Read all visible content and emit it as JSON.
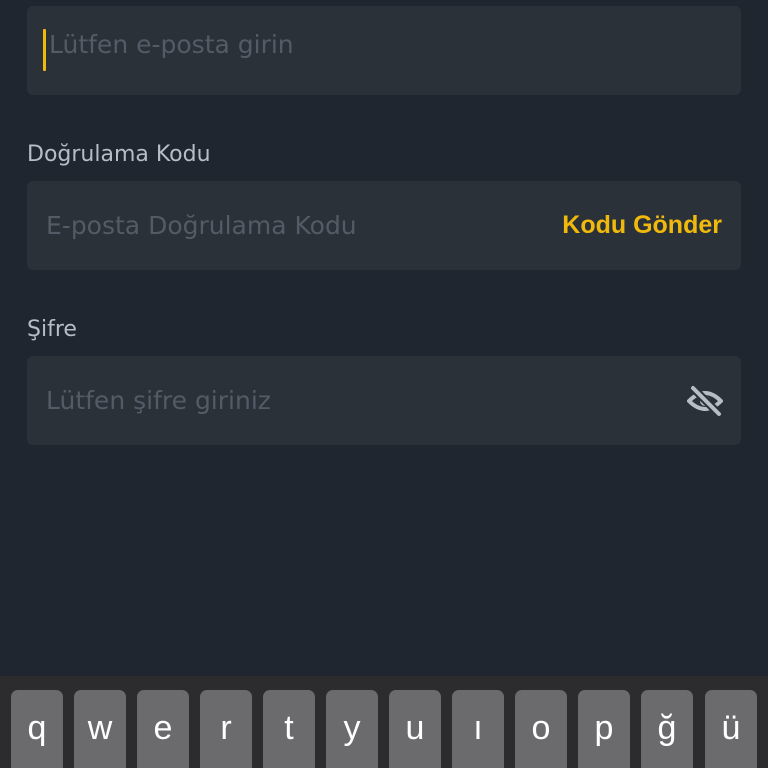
{
  "form": {
    "email": {
      "placeholder": "Lütfen e-posta girin"
    },
    "code": {
      "label": "Doğrulama Kodu",
      "placeholder": "E-posta Doğrulama Kodu",
      "send_button": "Kodu Gönder"
    },
    "password": {
      "label": "Şifre",
      "placeholder": "Lütfen şifre giriniz",
      "toggle_icon": "eye-off-icon"
    }
  },
  "keyboard": {
    "keys": [
      "q",
      "w",
      "e",
      "r",
      "t",
      "y",
      "u",
      "ı",
      "o",
      "p",
      "ğ",
      "ü"
    ]
  },
  "colors": {
    "background": "#1f2630",
    "field": "#2b3139",
    "accent": "#f0b90b",
    "label": "#b7bdc6",
    "placeholder": "#535b66"
  }
}
